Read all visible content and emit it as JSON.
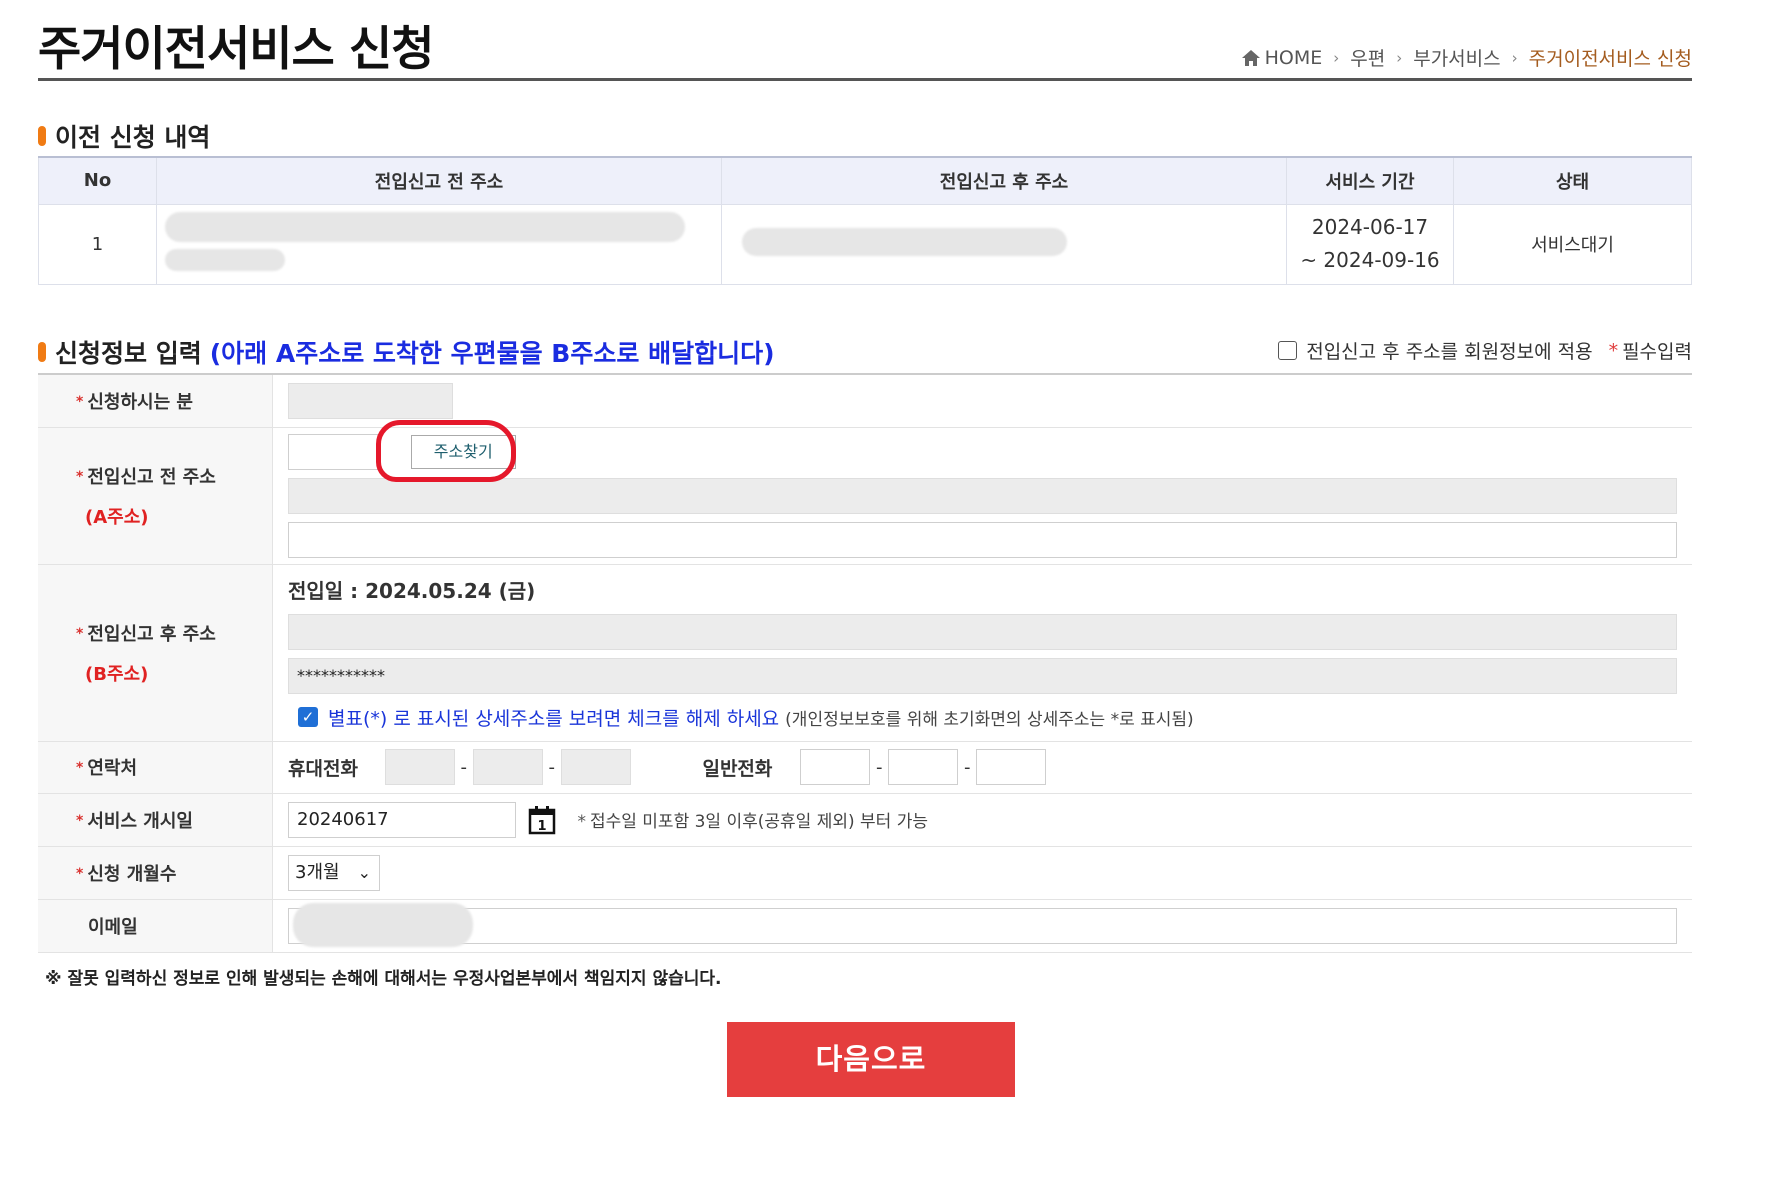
{
  "header": {
    "title": "주거이전서비스 신청",
    "breadcrumb": [
      "HOME",
      "우편",
      "부가서비스",
      "주거이전서비스 신청"
    ]
  },
  "history": {
    "title": "이전 신청 내역",
    "columns": [
      "No",
      "전입신고 전 주소",
      "전입신고 후 주소",
      "서비스 기간",
      "상태"
    ],
    "rows": [
      {
        "no": "1",
        "period_start": "2024-06-17",
        "period_end": "~ 2024-09-16",
        "status": "서비스대기"
      }
    ]
  },
  "form": {
    "title": "신청정보 입력",
    "title_note": "(아래 A주소로 도착한 우편물을 B주소로 배달합니다)",
    "apply_option_label": "전입신고 후 주소를 회원정보에 적용",
    "required_mark": "*",
    "required_label": "필수입력",
    "applicant_label": "신청하시는 분",
    "before_address_label": "전입신고 전 주소",
    "before_address_sub": "(A주소)",
    "find_address_button": "주소찾기",
    "after_address_label": "전입신고 후 주소",
    "after_address_sub": "(B주소)",
    "move_date": "전입일 : 2024.05.24 (금)",
    "after_detail_masked": "***********",
    "mask_check_text": "별표(*) 로 표시된 상세주소를 보려면 체크를 해제 하세요",
    "mask_check_note": "(개인정보보호를 위해 초기화면의 상세주소는 *로 표시됨)",
    "contact_label": "연락처",
    "mobile_label": "휴대전화",
    "phone_label": "일반전화",
    "phone_dash": "-",
    "start_date_label": "서비스 개시일",
    "start_date_value": "20240617",
    "start_date_hint_mark": "*",
    "start_date_hint": "접수일 미포함 3일 이후(공휴일 제외) 부터 가능",
    "months_label": "신청 개월수",
    "months_value": "3개월",
    "email_label": "이메일"
  },
  "disclaimer": "※ 잘못 입력하신 정보로 인해 발생되는 손해에 대해서는 우정사업본부에서 책임지지 않습니다.",
  "next_button": "다음으로",
  "colors": {
    "accent": "#f07b14",
    "title_blue": "#1a2ce0",
    "button_red": "#e53e3e",
    "annotation_red": "#e5182b",
    "breadcrumb_current": "#a45c1f"
  }
}
